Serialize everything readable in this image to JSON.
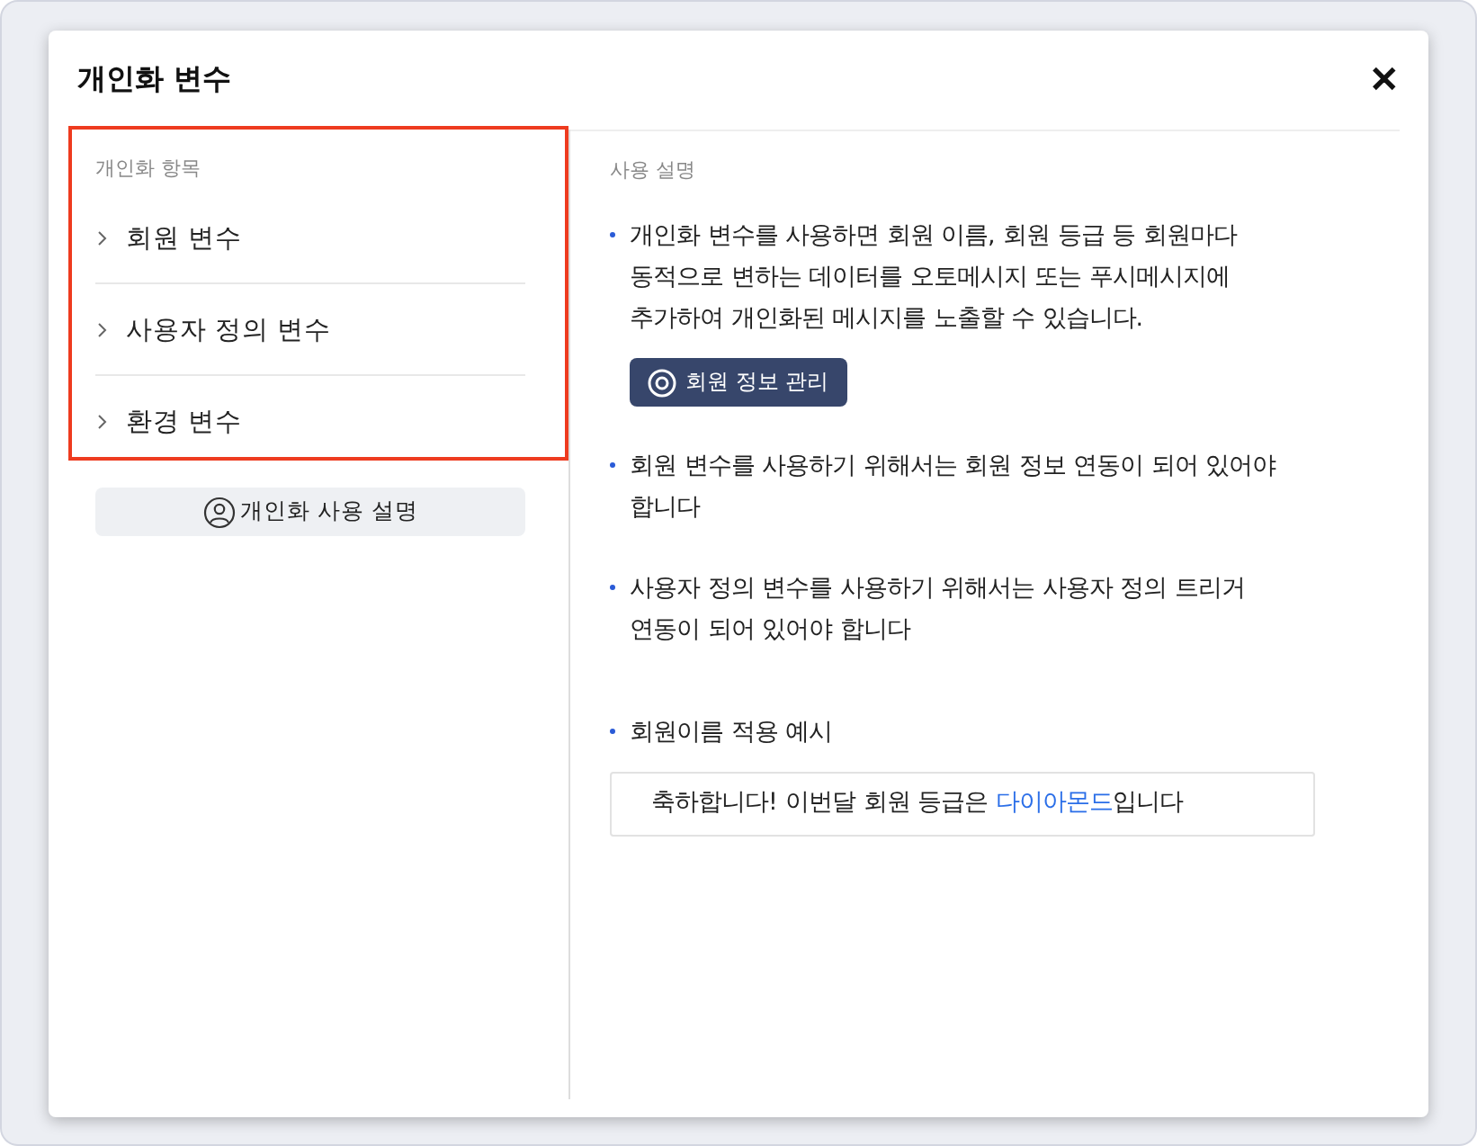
{
  "dialog": {
    "title": "개인화 변수",
    "close": "✕"
  },
  "sidebar": {
    "heading": "개인화 항목",
    "items": [
      {
        "label": "회원 변수"
      },
      {
        "label": "사용자 정의 변수"
      },
      {
        "label": "환경 변수"
      }
    ],
    "help_button": "개인화 사용 설명"
  },
  "content": {
    "heading": "사용 설명",
    "bullets": [
      {
        "text": "개인화 변수를 사용하면 회원 이름, 회원 등급 등 회원마다 동적으로 변하는 데이터를 오토메시지 또는 푸시메시지에 추가하여 개인화된 메시지를 노출할 수 있습니다.",
        "button": "회원 정보 관리"
      },
      {
        "text": "회원 변수를 사용하기 위해서는 회원 정보 연동이 되어 있어야 합니다"
      },
      {
        "text": "사용자 정의 변수를 사용하기 위해서는 사용자 정의 트리거 연동이 되어 있어야 합니다"
      },
      {
        "text": "회원이름 적용 예시"
      }
    ],
    "example": [
      {
        "kind": "plain",
        "text": "축하합니다! 이번달 회원 등급은 "
      },
      {
        "kind": "variable",
        "text": "다이아몬드"
      },
      {
        "kind": "plain",
        "text": "입니다"
      }
    ]
  }
}
